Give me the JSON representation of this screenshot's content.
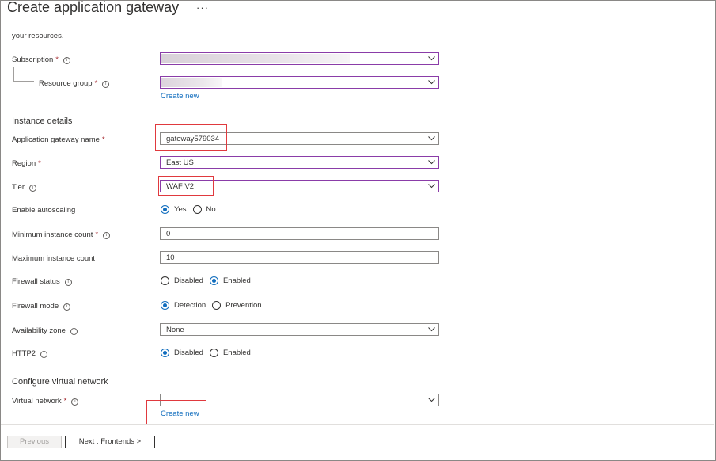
{
  "header": {
    "title": "Create application gateway",
    "more": "···"
  },
  "intro_text": "your resources.",
  "project": {
    "subscription_label": "Subscription",
    "resource_group_label": "Resource group",
    "create_new_link": "Create new"
  },
  "instance": {
    "section_title": "Instance details",
    "name_label": "Application gateway name",
    "name_value": "gateway579034",
    "region_label": "Region",
    "region_value": "East US",
    "tier_label": "Tier",
    "tier_value": "WAF V2",
    "autoscale_label": "Enable autoscaling",
    "autoscale_yes": "Yes",
    "autoscale_no": "No",
    "min_label": "Minimum instance count",
    "min_value": "0",
    "max_label": "Maximum instance count",
    "max_value": "10",
    "fw_status_label": "Firewall status",
    "fw_status_disabled": "Disabled",
    "fw_status_enabled": "Enabled",
    "fw_mode_label": "Firewall mode",
    "fw_mode_detection": "Detection",
    "fw_mode_prevention": "Prevention",
    "az_label": "Availability zone",
    "az_value": "None",
    "http2_label": "HTTP2",
    "http2_disabled": "Disabled",
    "http2_enabled": "Enabled"
  },
  "network": {
    "section_title": "Configure virtual network",
    "vnet_label": "Virtual network",
    "create_new_link": "Create new"
  },
  "footer": {
    "previous_label": "Previous",
    "next_label": "Next : Frontends >"
  },
  "colors": {
    "accent": "#0f6cbd",
    "highlight": "#e0393e",
    "required": "#a4262c",
    "select_border": "#8a3ca8"
  }
}
